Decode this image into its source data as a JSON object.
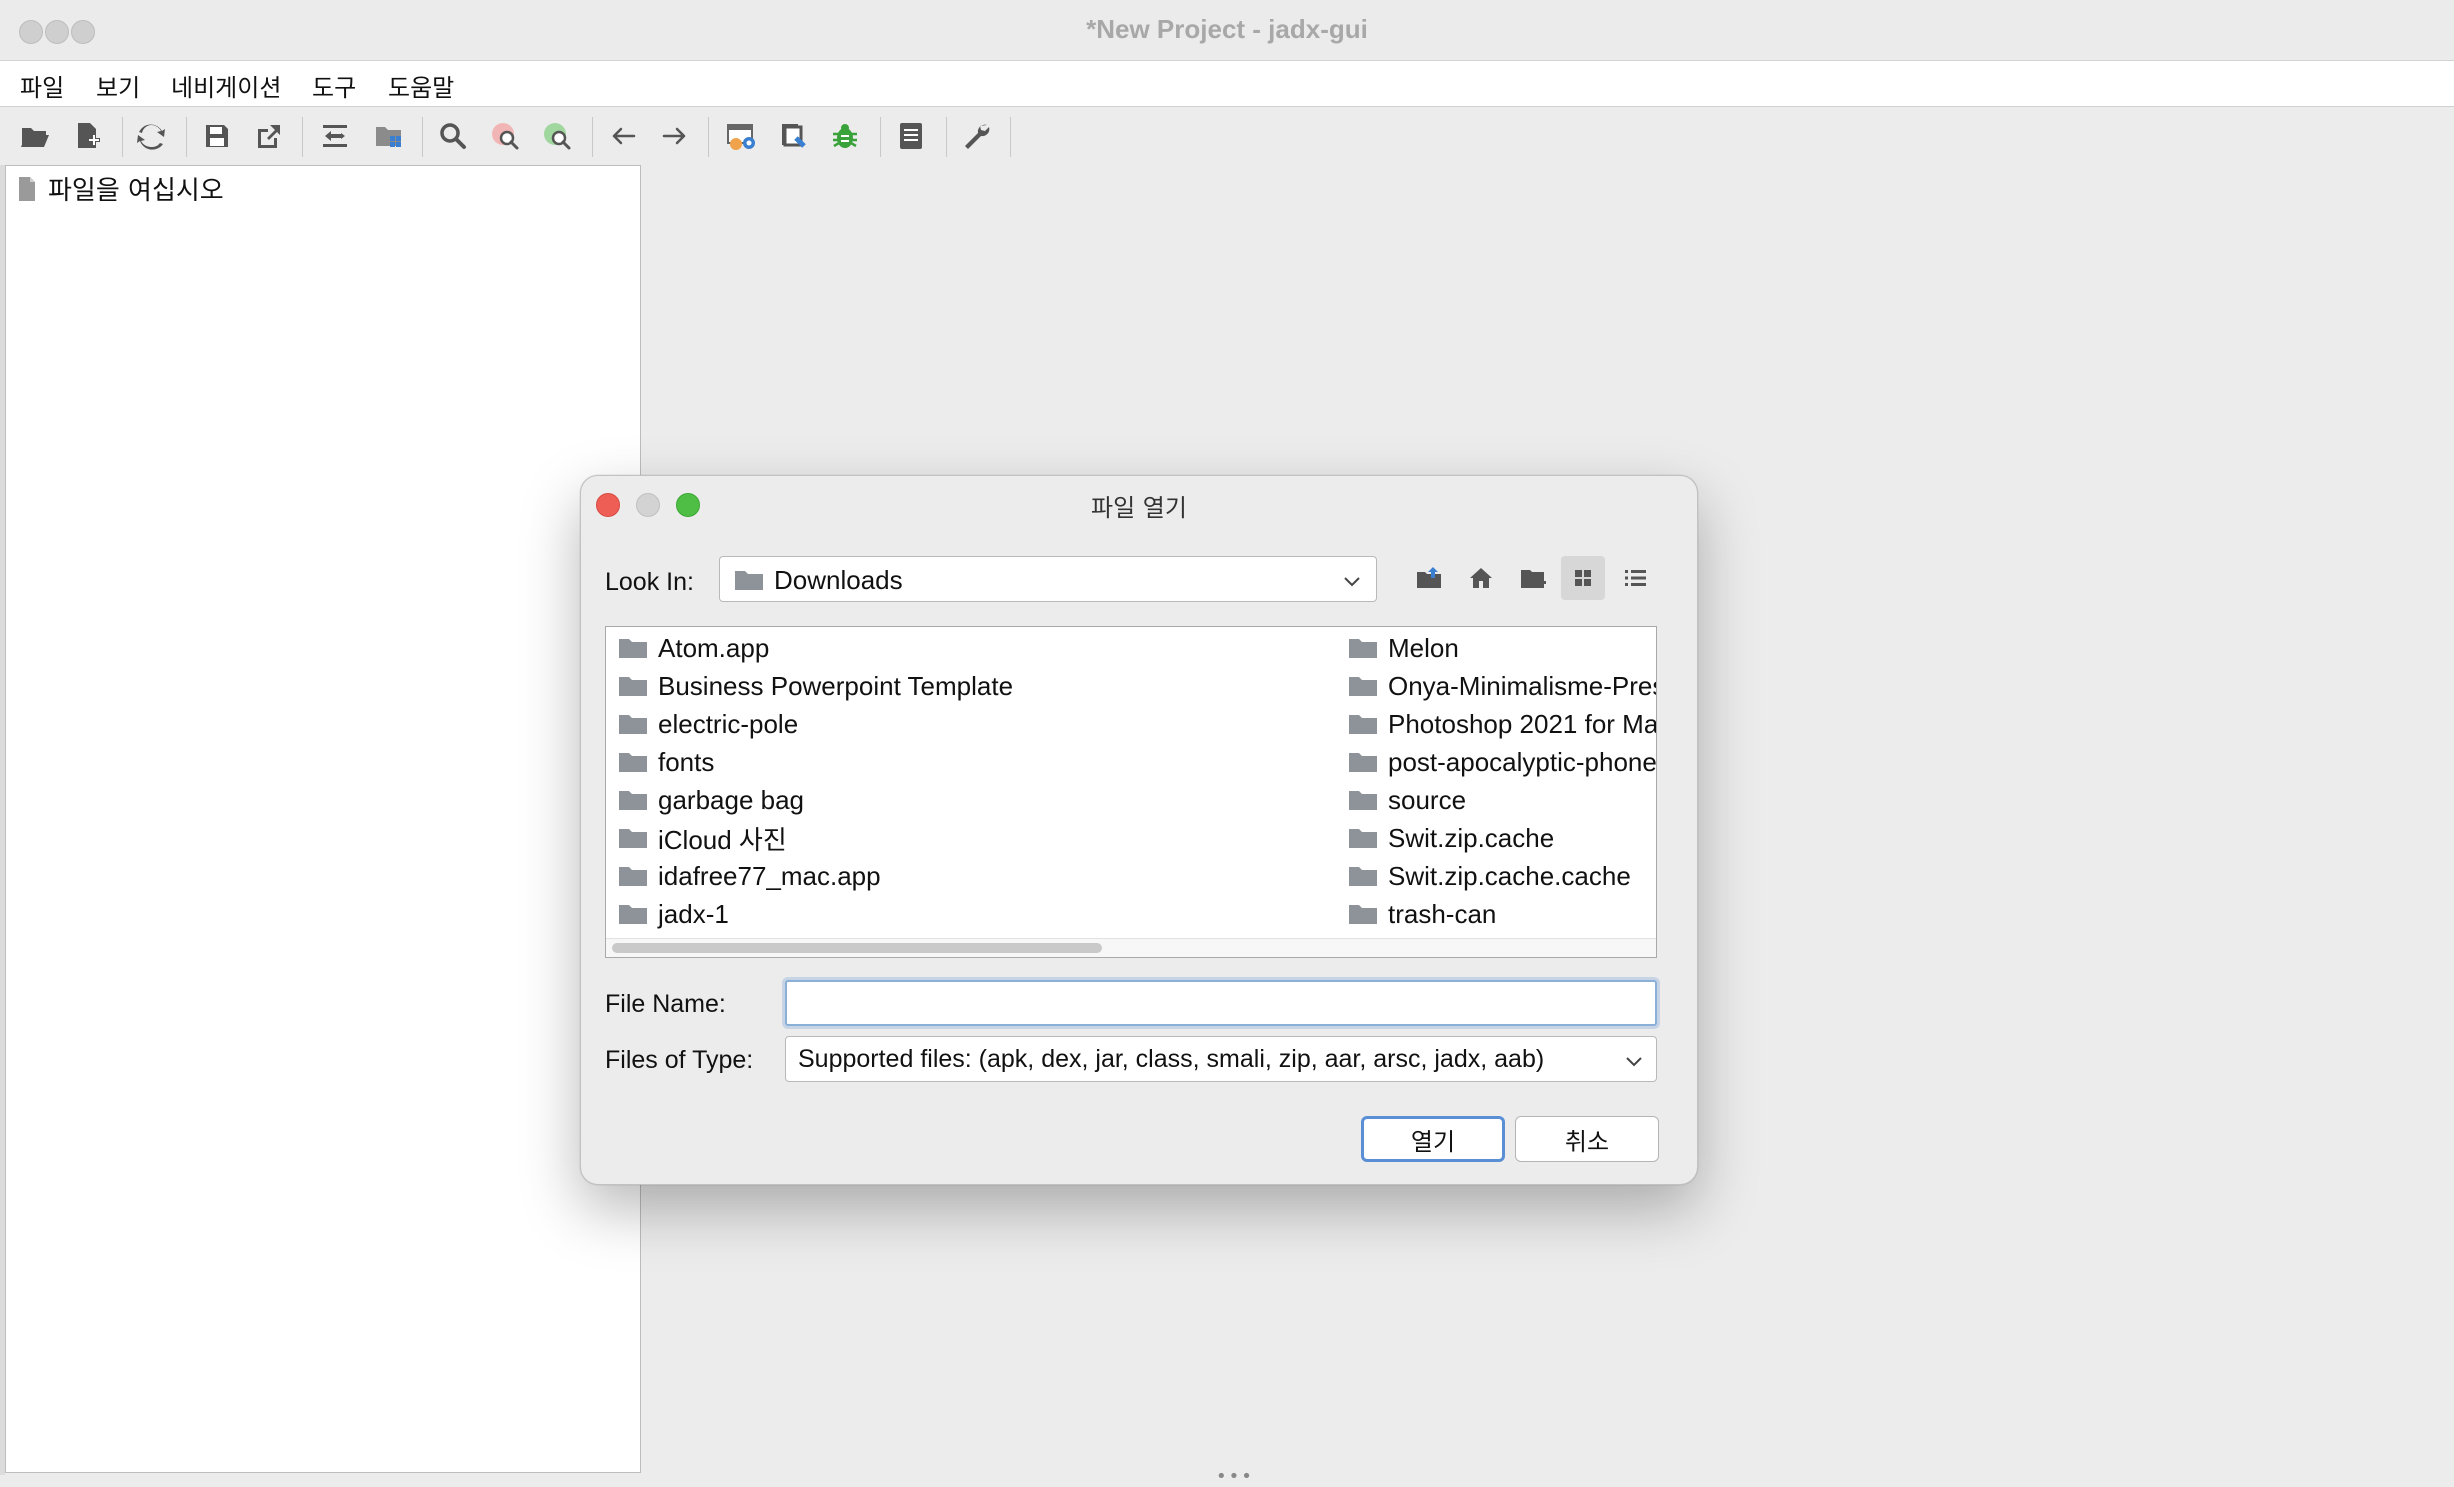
{
  "window": {
    "title": "*New Project - jadx-gui"
  },
  "menu": {
    "items": [
      "파일",
      "보기",
      "네비게이션",
      "도구",
      "도움말"
    ]
  },
  "toolbar": {
    "icons": [
      "open-file-icon",
      "add-files-icon",
      "reload-icon",
      "save-icon",
      "export-icon",
      "sync-icon",
      "package-tree-icon",
      "search-icon",
      "find-usage-icon",
      "find-class-icon",
      "back-icon",
      "forward-icon",
      "deobfuscation-icon",
      "quark-icon",
      "debug-icon",
      "log-icon",
      "preferences-icon"
    ]
  },
  "tree": {
    "placeholder": "파일을  여십시오"
  },
  "dialog": {
    "title": "파일 열기",
    "look_in_label": "Look In:",
    "look_in_value": "Downloads",
    "files_col1": [
      "Atom.app",
      "Business Powerpoint Template",
      "electric-pole",
      "fonts",
      "garbage bag",
      "iCloud 사진",
      "idafree77_mac.app",
      "jadx-1"
    ],
    "files_col2": [
      "Melon",
      "Onya-Minimalisme-Pres",
      "Photoshop 2021 for Ma",
      "post-apocalyptic-phone",
      "source",
      "Swit.zip.cache",
      "Swit.zip.cache.cache",
      "trash-can"
    ],
    "file_name_label": "File Name:",
    "file_name_value": "",
    "file_type_label": "Files of Type:",
    "file_type_value": "Supported files: (apk, dex, jar, class, smali, zip, aar, arsc, jadx, aab)",
    "open_button": "열기",
    "cancel_button": "취소"
  },
  "colors": {
    "close_red": "#ee5e55",
    "min_gray": "#d3d3d3",
    "zoom_green": "#4fbe45",
    "focus_blue": "#5a8fd6"
  }
}
